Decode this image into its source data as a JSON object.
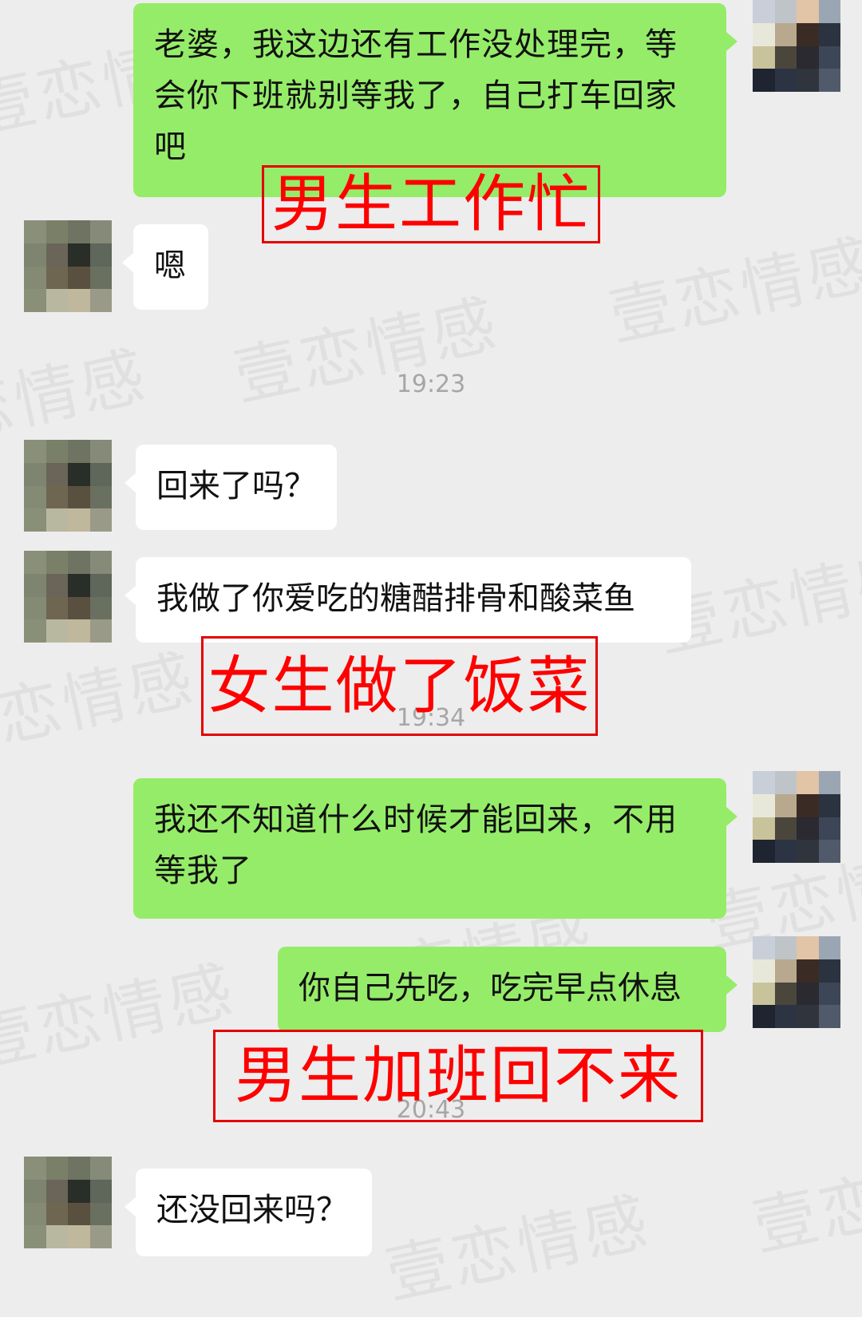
{
  "watermark": "壹恋情感",
  "messages": [
    {
      "side": "me",
      "text": "老婆，我这边还有工作没处理完，等会你下班就别等我了，自己打车回家吧"
    },
    {
      "side": "other",
      "text": "嗯"
    },
    {
      "side": "other",
      "text": "回来了吗？"
    },
    {
      "side": "other",
      "text": "我做了你爱吃的糖醋排骨和酸菜鱼"
    },
    {
      "side": "me",
      "text": "我还不知道什么时候才能回来，不用等我了"
    },
    {
      "side": "me",
      "text": "你自己先吃，吃完早点休息"
    },
    {
      "side": "other",
      "text": "还没回来吗？"
    }
  ],
  "timestamps": [
    "19:23",
    "19:34",
    "20:43"
  ],
  "annotations": [
    "男生工作忙",
    "女生做了饭菜",
    "男生加班回不来"
  ],
  "colors": {
    "background": "#ededed",
    "my_bubble": "#95ec69",
    "other_bubble": "#ffffff",
    "annotation": "#ff0000",
    "timestamp": "#a6a6a6"
  }
}
